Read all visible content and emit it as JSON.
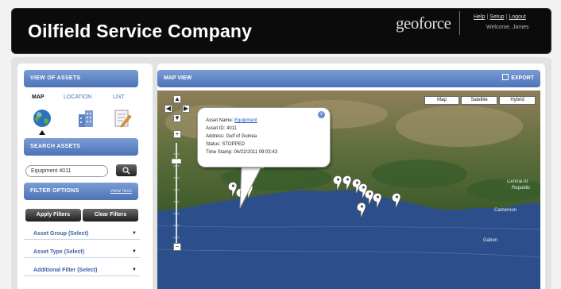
{
  "header": {
    "app_title": "Oilfield Service Company",
    "logo_text": "geoforce",
    "links": [
      "Help",
      "Setup",
      "Logout"
    ],
    "welcome": "Welcome, James"
  },
  "left_panel": {
    "view_assets_title": "VIEW OF ASSETS",
    "view_tabs": [
      "MAP",
      "LOCATION",
      "LIST"
    ],
    "search_assets_title": "SEARCH ASSETS",
    "search_value": "Equipment 4011",
    "filter_options_title": "FILTER OPTIONS",
    "filter_view_link": "view less",
    "apply_filters_label": "Apply Filters",
    "clear_filters_label": "Clear Filters",
    "dropdowns": [
      "Asset Group (Select)",
      "Asset Type (Select)",
      "Additional Filter (Select)"
    ]
  },
  "map_panel": {
    "title": "MAP VIEW",
    "export_label": "EXPORT",
    "map_types": [
      "Map",
      "Satellite",
      "Hybrid"
    ],
    "zoom_in": "+",
    "zoom_out": "−",
    "info_window": {
      "asset_name_label": "Asset Name:",
      "asset_name_value": "Equipment",
      "asset_id": "Asset ID: 4011",
      "address": "Address: Gulf of Guinea",
      "status": "Status: STOPPED",
      "time_stamp": "Time Stamp: 04/22/2011 09:03:43",
      "close": "x"
    },
    "map_labels": [
      "Central Af",
      "Republic",
      "Cameroon",
      "Gabon"
    ]
  },
  "colors": {
    "header_bg": "#0b0b0b",
    "bar_blue": "#4d73b8",
    "link_blue": "#3c62a8",
    "ocean": "#2c4f8c"
  }
}
